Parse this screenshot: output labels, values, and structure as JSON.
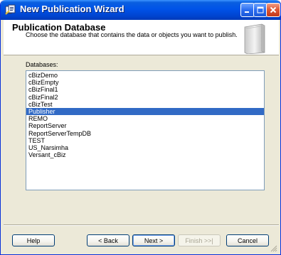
{
  "window": {
    "title": "New Publication Wizard"
  },
  "header": {
    "title": "Publication Database",
    "subtitle": "Choose the database that contains the data or objects you want to publish."
  },
  "databases": {
    "label": "Databases:",
    "items": [
      "cBizDemo",
      "cBizEmpty",
      "cBizFinal1",
      "cBizFinal2",
      "cBizTest",
      "Publisher",
      "REMO",
      "ReportServer",
      "ReportServerTempDB",
      "TEST",
      "US_Narsimha",
      "Versant_cBiz"
    ],
    "selected": "Publisher"
  },
  "buttons": {
    "help": "Help",
    "back": "< Back",
    "next": "Next >",
    "finish": "Finish >>|",
    "cancel": "Cancel"
  },
  "colors": {
    "titlebar": "#0053e8",
    "selection": "#316ac5",
    "dialog_bg": "#ece9d8"
  }
}
